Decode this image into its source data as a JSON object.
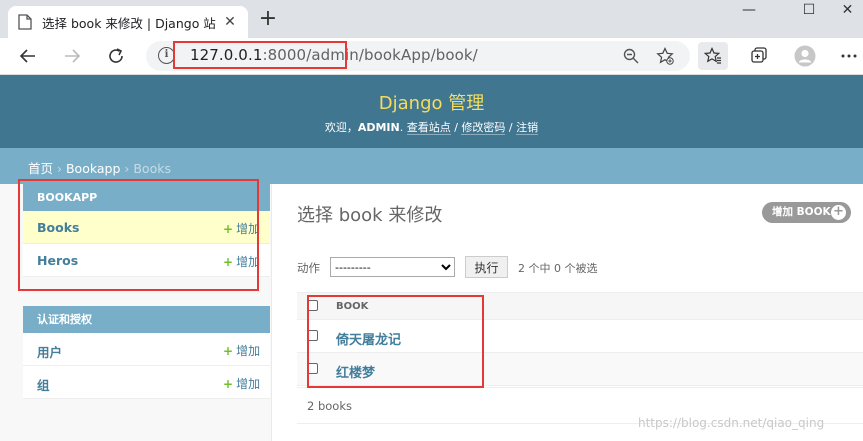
{
  "browser": {
    "tab_title": "选择 book 来修改 | Django 站点管",
    "url_host": "127.0.0.1",
    "url_rest": ":8000/admin/bookApp/book/"
  },
  "header": {
    "branding": "Django 管理",
    "welcome": "欢迎，",
    "username": "ADMIN",
    "view_site": "查看站点",
    "change_password": "修改密码",
    "logout": "注销",
    "sep": " / "
  },
  "breadcrumbs": {
    "home": "首页",
    "app": "Bookapp",
    "current": "Books",
    "sep": " › "
  },
  "sidebar": {
    "modules": [
      {
        "caption": "BOOKAPP",
        "rows": [
          {
            "name": "Books",
            "add": "增加"
          },
          {
            "name": "Heros",
            "add": "增加"
          }
        ]
      },
      {
        "caption": "认证和授权",
        "rows": [
          {
            "name": "用户",
            "add": "增加"
          },
          {
            "name": "组",
            "add": "增加"
          }
        ]
      }
    ]
  },
  "content": {
    "title": "选择 book 来修改",
    "add_button": "增加 BOOK",
    "action_label": "动作",
    "action_option": "---------",
    "go_button": "执行",
    "counter": "2 个中 0 个被选",
    "column_header": "BOOK",
    "rows": [
      "倚天屠龙记",
      "红楼梦"
    ],
    "paginator": "2 books"
  },
  "watermark": "https://blog.csdn.net/qiao_qing",
  "colors": {
    "header_bg": "#417690",
    "branding": "#f5dd5d",
    "breadcrumb_bg": "#79aec8",
    "link": "#447e9b",
    "add_plus": "#70bf2b",
    "current_row": "#ffffcc",
    "annotation_red": "#e53935"
  }
}
